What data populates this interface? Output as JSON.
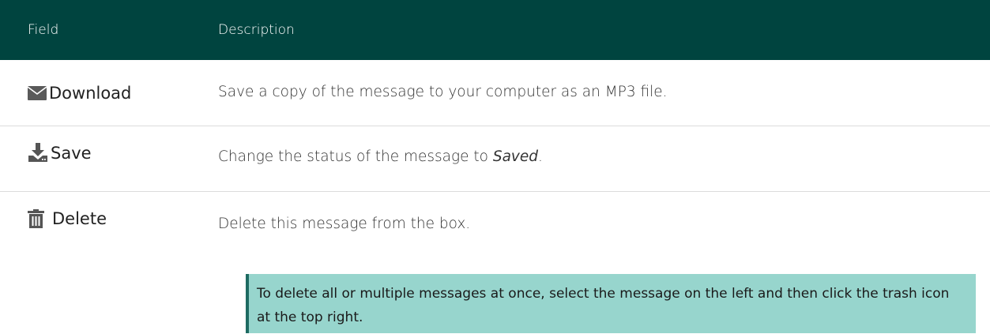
{
  "header": {
    "field_label": "Field",
    "description_label": "Description"
  },
  "rows": [
    {
      "icon": "envelope-icon",
      "label": "Download",
      "description": "Save a copy of the message to your computer as an MP3 file."
    },
    {
      "icon": "download-tray-icon",
      "label": "Save",
      "description_prefix": "Change the status of the message to ",
      "description_emphasis": "Saved",
      "description_suffix": "."
    },
    {
      "icon": "trash-icon",
      "label": "Delete",
      "description": "Delete this message from the box."
    }
  ],
  "note": {
    "text": "To delete all or multiple messages at once, select the message on the left and then click the trash icon at the top right."
  },
  "colors": {
    "header_bg": "#00443f",
    "note_bg": "#97d5cd",
    "note_border": "#1e6b62"
  }
}
